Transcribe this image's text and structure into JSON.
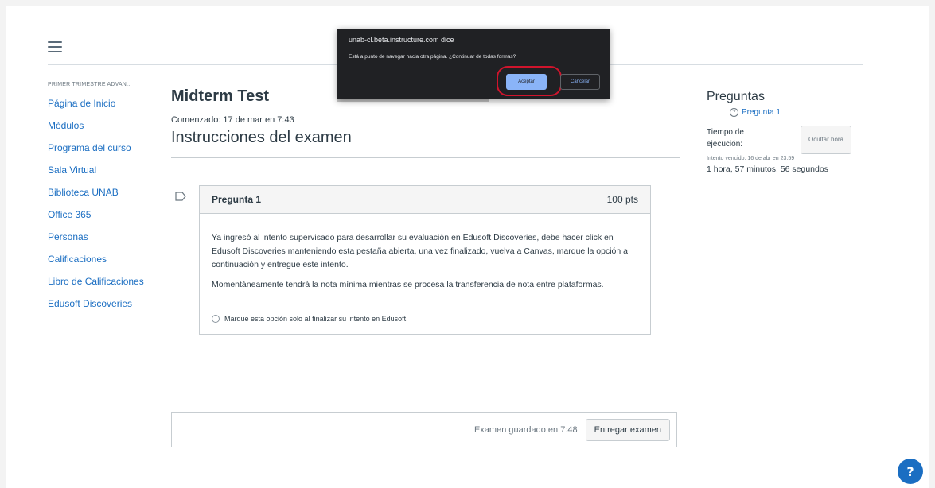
{
  "course": {
    "name": "PRIMER TRIMESTRE ADVAN...",
    "nav_items": [
      {
        "label": "Página de Inicio"
      },
      {
        "label": "Módulos"
      },
      {
        "label": "Programa del curso"
      },
      {
        "label": "Sala Virtual"
      },
      {
        "label": "Biblioteca UNAB"
      },
      {
        "label": "Office 365"
      },
      {
        "label": "Personas"
      },
      {
        "label": "Calificaciones"
      },
      {
        "label": "Libro de Calificaciones"
      },
      {
        "label": "Edusoft Discoveries"
      }
    ]
  },
  "quiz": {
    "title": "Midterm Test",
    "started": "Comenzado: 17 de mar en 7:43",
    "section_title": "Instrucciones del examen",
    "question": {
      "name": "Pregunta 1",
      "points": "100 pts",
      "paragraphs": [
        "Ya ingresó al intento supervisado para desarrollar su evaluación en Edusoft Discoveries, debe hacer click en Edusoft Discoveries manteniendo esta pestaña abierta, una vez finalizado, vuelva a Canvas, marque la opción a continuación y entregue este intento.",
        "Momentáneamente tendrá la nota mínima mientras se procesa la transferencia de nota entre plataformas."
      ],
      "answer": "Marque esta opción solo al finalizar su intento en Edusoft"
    },
    "saved_text": "Examen guardado en 7:48",
    "submit_label": "Entregar examen"
  },
  "sidebar": {
    "heading": "Preguntas",
    "question_link": "Pregunta 1",
    "timer_label": "Tiempo de ejecución:",
    "hide_label": "Ocultar hora",
    "deadline": "Intento vencido: 16 de abr en 23:59",
    "time_remaining": "1 hora, 57 minutos, 56 segundos"
  },
  "dialog": {
    "title": "unab-cl.beta.instructure.com dice",
    "message": "Está a punto de navegar hacia otra página. ¿Continuar de todas formas?",
    "ok_label": "Aceptar",
    "cancel_label": "Cancelar"
  },
  "colors": {
    "link": "#1b6ec2",
    "dialog_bg": "#202124",
    "dialog_ok": "#8ab4f8",
    "highlight": "#d0142c",
    "help": "#1b6ec2"
  },
  "icons": {
    "menu": "hamburger-menu-icon",
    "flag": "flag-outline-icon",
    "question": "question-circle-icon",
    "help": "help-icon"
  }
}
